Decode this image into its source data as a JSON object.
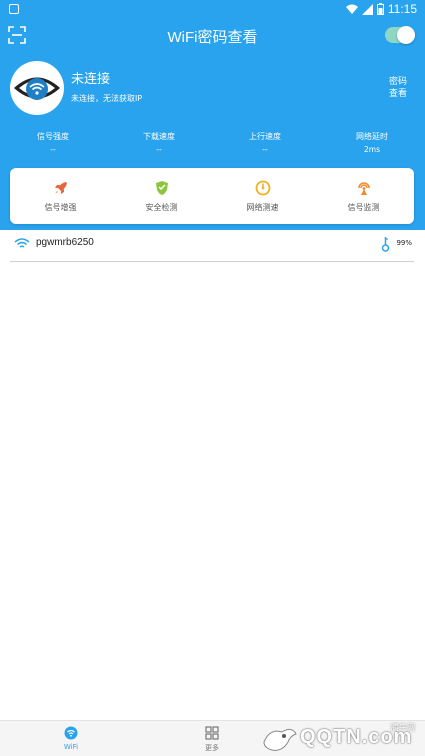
{
  "status_bar": {
    "time": "11:15"
  },
  "app": {
    "title": "WiFi密码查看"
  },
  "connection": {
    "title": "未连接",
    "subtitle": "未连接，无法获取IP",
    "password_button_line1": "密码",
    "password_button_line2": "查看"
  },
  "stats": [
    {
      "label": "信号强度",
      "value": "--"
    },
    {
      "label": "下载速度",
      "value": "--"
    },
    {
      "label": "上行速度",
      "value": "--"
    },
    {
      "label": "网络延时",
      "value": "2ms"
    }
  ],
  "tools": [
    {
      "label": "信号增强",
      "icon": "rocket-icon",
      "color": "#e8643c"
    },
    {
      "label": "安全检测",
      "icon": "shield-icon",
      "color": "#8cc63e"
    },
    {
      "label": "网络测速",
      "icon": "speedometer-icon",
      "color": "#f2b01e"
    },
    {
      "label": "信号监测",
      "icon": "signal-monitor-icon",
      "color": "#f08a2c"
    }
  ],
  "networks": [
    {
      "ssid": "pgwmrb6250",
      "signal": "99%"
    }
  ],
  "bottom_nav": [
    {
      "label": "WiFi",
      "icon": "wifi-icon"
    },
    {
      "label": "更多",
      "icon": "grid-icon"
    }
  ],
  "watermark": {
    "text": "QQTN.com",
    "cn": "腾牛网"
  },
  "colors": {
    "primary": "#29a3ee",
    "toggle_track": "#8fd7c4"
  }
}
